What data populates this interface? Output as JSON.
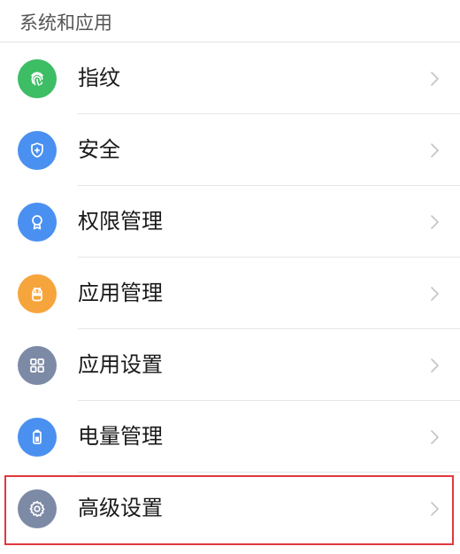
{
  "section": {
    "title": "系统和应用"
  },
  "items": [
    {
      "label": "指纹",
      "icon": "fingerprint-icon",
      "color": "#3dbd64"
    },
    {
      "label": "安全",
      "icon": "shield-icon",
      "color": "#4a90f0"
    },
    {
      "label": "权限管理",
      "icon": "badge-icon",
      "color": "#4a90f0"
    },
    {
      "label": "应用管理",
      "icon": "android-icon",
      "color": "#f6a53c"
    },
    {
      "label": "应用设置",
      "icon": "grid-icon",
      "color": "#7d8aa6"
    },
    {
      "label": "电量管理",
      "icon": "battery-icon",
      "color": "#4a90f0"
    },
    {
      "label": "高级设置",
      "icon": "gear-icon",
      "color": "#7d8aa6"
    }
  ],
  "highlight": {
    "color": "#e0383e",
    "target": "高级设置"
  }
}
